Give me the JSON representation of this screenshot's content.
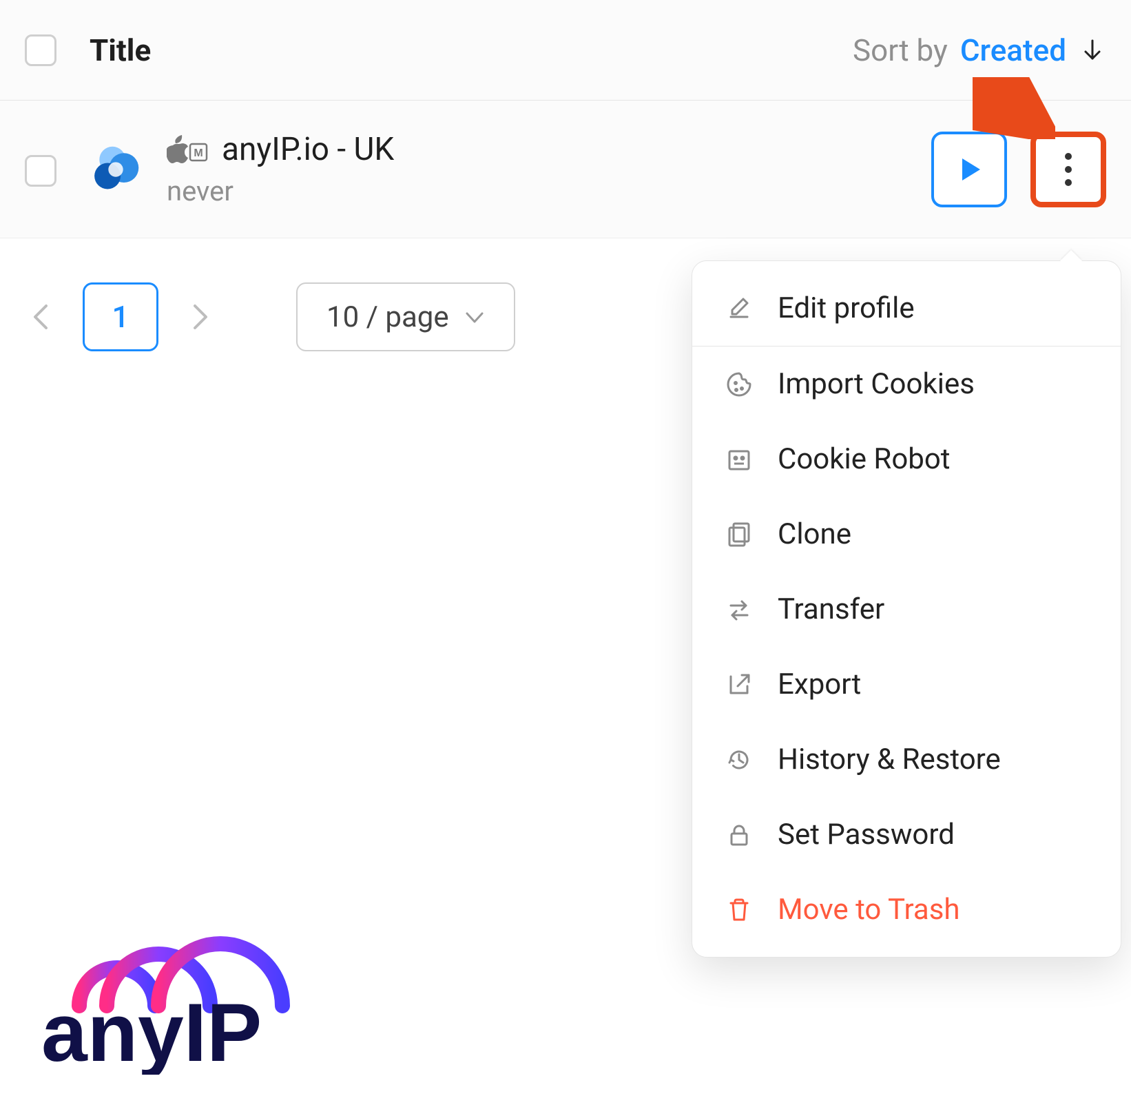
{
  "header": {
    "title": "Title",
    "sort_label": "Sort by",
    "sort_value": "Created"
  },
  "row": {
    "name": "anyIP.io - UK",
    "status": "never"
  },
  "pagination": {
    "page": "1",
    "size_label": "10 / page"
  },
  "menu": {
    "items": [
      {
        "label": "Edit profile"
      },
      {
        "label": "Import Cookies"
      },
      {
        "label": "Cookie Robot"
      },
      {
        "label": "Clone"
      },
      {
        "label": "Transfer"
      },
      {
        "label": "Export"
      },
      {
        "label": "History & Restore"
      },
      {
        "label": "Set Password"
      },
      {
        "label": "Move to Trash"
      }
    ]
  },
  "colors": {
    "accent_blue": "#1a8cff",
    "highlight_orange": "#e84a1a",
    "danger": "#ff5a3d"
  },
  "logo": {
    "text": "anyIP"
  }
}
